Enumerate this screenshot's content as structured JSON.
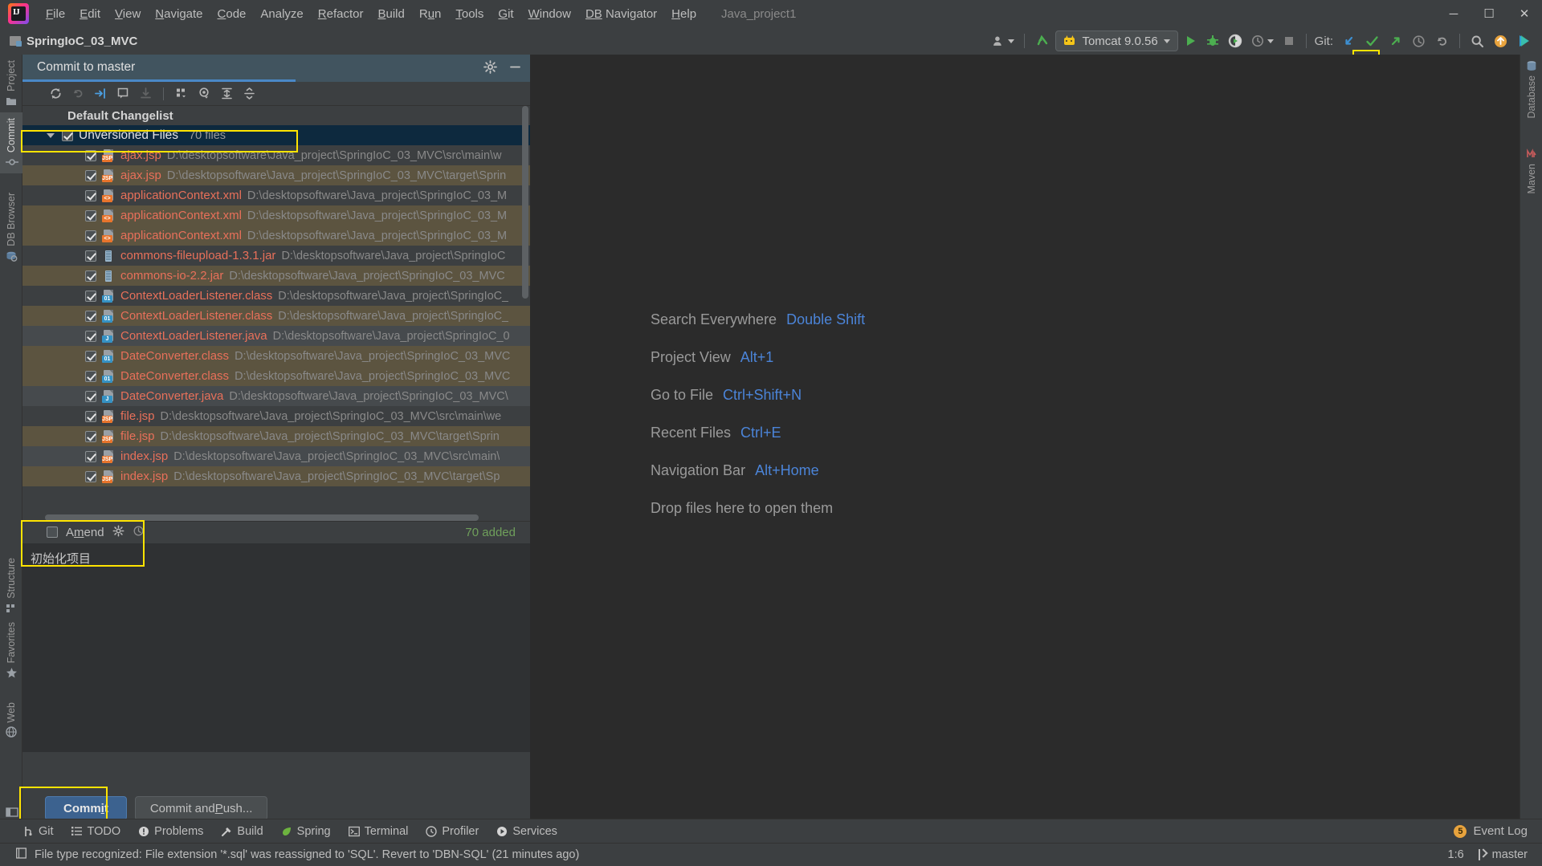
{
  "window": {
    "title": "Java_project1",
    "controls": {
      "minimize": "—",
      "maximize": "❐",
      "close": "✕"
    }
  },
  "menubar": {
    "logo": "intellij-idea-logo",
    "items": [
      {
        "label": "File",
        "mnemonic": "F"
      },
      {
        "label": "Edit",
        "mnemonic": "E"
      },
      {
        "label": "View",
        "mnemonic": "V"
      },
      {
        "label": "Navigate",
        "mnemonic": "N"
      },
      {
        "label": "Code",
        "mnemonic": "C"
      },
      {
        "label": "Analyze",
        "mnemonic": ""
      },
      {
        "label": "Refactor",
        "mnemonic": "R"
      },
      {
        "label": "Build",
        "mnemonic": "B"
      },
      {
        "label": "Run",
        "mnemonic": "u"
      },
      {
        "label": "Tools",
        "mnemonic": "T"
      },
      {
        "label": "Git",
        "mnemonic": "G"
      },
      {
        "label": "Window",
        "mnemonic": "W"
      },
      {
        "label": "DB Navigator",
        "mnemonic": "DB"
      },
      {
        "label": "Help",
        "mnemonic": "H"
      }
    ]
  },
  "navbar": {
    "project_name": "SpringIoC_03_MVC",
    "run_config": "Tomcat 9.0.56",
    "git_label": "Git:",
    "icons": {
      "user": "user-icon",
      "update_project": "update-project-icon",
      "run": "run-icon",
      "debug": "debug-icon",
      "run_coverage": "run-with-coverage-icon",
      "profile": "profile-icon",
      "stop": "stop-icon",
      "git_update": "git-update-icon",
      "git_commit": "git-commit-checkmark-icon",
      "git_push": "git-push-icon",
      "git_history": "git-history-icon",
      "git_rollback": "git-rollback-icon",
      "search": "search-icon",
      "ide_update": "ide-update-icon",
      "run_dashboard": "run-dashboard-icon"
    }
  },
  "left_strip": [
    {
      "label": "Project",
      "icon": "project-folder-icon",
      "active": false
    },
    {
      "label": "Commit",
      "icon": "commit-icon",
      "active": true
    },
    {
      "label": "DB Browser",
      "icon": "db-browser-icon",
      "active": false
    },
    {
      "label": "Structure",
      "icon": "structure-icon",
      "active": false
    },
    {
      "label": "Favorites",
      "icon": "star-icon",
      "active": false
    },
    {
      "label": "Web",
      "icon": "web-globe-icon",
      "active": false
    }
  ],
  "right_strip": [
    {
      "label": "Database",
      "icon": "database-icon"
    },
    {
      "label": "Maven",
      "icon": "maven-icon"
    }
  ],
  "commit_panel": {
    "tab_title": "Commit to master",
    "header_icons": {
      "settings": "gear-icon",
      "hide": "minimize-icon"
    },
    "toolbar_icons": [
      "refresh-icon",
      "rollback-icon",
      "diff-icon",
      "show-diff-icon",
      "download-icon",
      "group-by-icon",
      "preview-icon",
      "expand-all-icon",
      "collapse-all-icon"
    ],
    "changelist_title": "Default Changelist",
    "group": {
      "name": "Unversioned Files",
      "count": "70 files",
      "checked": true,
      "expanded": true,
      "highlighted": true
    },
    "files": [
      {
        "name": "ajax.jsp",
        "path": "D:\\desktopsoftware\\Java_project\\SpringIoC_03_MVC\\src\\main\\w",
        "type": "jsp",
        "checked": true,
        "row_style": "normal"
      },
      {
        "name": "ajax.jsp",
        "path": "D:\\desktopsoftware\\Java_project\\SpringIoC_03_MVC\\target\\Sprin",
        "type": "jsp",
        "checked": true,
        "row_style": "alt"
      },
      {
        "name": "applicationContext.xml",
        "path": "D:\\desktopsoftware\\Java_project\\SpringIoC_03_M",
        "type": "xml",
        "checked": true,
        "row_style": "normal"
      },
      {
        "name": "applicationContext.xml",
        "path": "D:\\desktopsoftware\\Java_project\\SpringIoC_03_M",
        "type": "xml",
        "checked": true,
        "row_style": "alt"
      },
      {
        "name": "applicationContext.xml",
        "path": "D:\\desktopsoftware\\Java_project\\SpringIoC_03_M",
        "type": "xml",
        "checked": true,
        "row_style": "alt"
      },
      {
        "name": "commons-fileupload-1.3.1.jar",
        "path": "D:\\desktopsoftware\\Java_project\\SpringIoC",
        "type": "jar",
        "checked": true,
        "row_style": "normal"
      },
      {
        "name": "commons-io-2.2.jar",
        "path": "D:\\desktopsoftware\\Java_project\\SpringIoC_03_MVC",
        "type": "jar",
        "checked": true,
        "row_style": "alt"
      },
      {
        "name": "ContextLoaderListener.class",
        "path": "D:\\desktopsoftware\\Java_project\\SpringIoC_",
        "type": "class",
        "checked": true,
        "row_style": "normal"
      },
      {
        "name": "ContextLoaderListener.class",
        "path": "D:\\desktopsoftware\\Java_project\\SpringIoC_",
        "type": "class",
        "checked": true,
        "row_style": "alt"
      },
      {
        "name": "ContextLoaderListener.java",
        "path": "D:\\desktopsoftware\\Java_project\\SpringIoC_0",
        "type": "java",
        "checked": true,
        "row_style": "sel"
      },
      {
        "name": "DateConverter.class",
        "path": "D:\\desktopsoftware\\Java_project\\SpringIoC_03_MVC",
        "type": "class",
        "checked": true,
        "row_style": "alt"
      },
      {
        "name": "DateConverter.class",
        "path": "D:\\desktopsoftware\\Java_project\\SpringIoC_03_MVC",
        "type": "class",
        "checked": true,
        "row_style": "alt"
      },
      {
        "name": "DateConverter.java",
        "path": "D:\\desktopsoftware\\Java_project\\SpringIoC_03_MVC\\",
        "type": "java",
        "checked": true,
        "row_style": "sel"
      },
      {
        "name": "file.jsp",
        "path": "D:\\desktopsoftware\\Java_project\\SpringIoC_03_MVC\\src\\main\\we",
        "type": "jsp",
        "checked": true,
        "row_style": "normal"
      },
      {
        "name": "file.jsp",
        "path": "D:\\desktopsoftware\\Java_project\\SpringIoC_03_MVC\\target\\Sprin",
        "type": "jsp",
        "checked": true,
        "row_style": "alt"
      },
      {
        "name": "index.jsp",
        "path": "D:\\desktopsoftware\\Java_project\\SpringIoC_03_MVC\\src\\main\\",
        "type": "jsp",
        "checked": true,
        "row_style": "sel"
      },
      {
        "name": "index.jsp",
        "path": "D:\\desktopsoftware\\Java_project\\SpringIoC_03_MVC\\target\\Sp",
        "type": "jsp",
        "checked": true,
        "row_style": "alt"
      }
    ],
    "amend": {
      "label": "Amend",
      "checked": false,
      "mnemonic": "m"
    },
    "added_count": "70 added",
    "commit_message": "初始化项目",
    "commit_message_highlighted": true,
    "buttons": {
      "commit": "Commit",
      "commit_and_push": "Commit and Push..."
    }
  },
  "editor": {
    "tips": [
      {
        "name": "Search Everywhere",
        "key": "Double Shift"
      },
      {
        "name": "Project View",
        "key": "Alt+1"
      },
      {
        "name": "Go to File",
        "key": "Ctrl+Shift+N"
      },
      {
        "name": "Recent Files",
        "key": "Ctrl+E"
      },
      {
        "name": "Navigation Bar",
        "key": "Alt+Home"
      }
    ],
    "drop_hint": "Drop files here to open them"
  },
  "bottom_toolbar": {
    "items": [
      {
        "label": "Git",
        "icon": "git-branch-icon"
      },
      {
        "label": "TODO",
        "icon": "todo-list-icon"
      },
      {
        "label": "Problems",
        "icon": "problems-icon"
      },
      {
        "label": "Build",
        "icon": "build-hammer-icon"
      },
      {
        "label": "Spring",
        "icon": "spring-leaf-icon"
      },
      {
        "label": "Terminal",
        "icon": "terminal-icon"
      },
      {
        "label": "Profiler",
        "icon": "profiler-icon"
      },
      {
        "label": "Services",
        "icon": "services-icon"
      }
    ],
    "event_log": {
      "label": "Event Log",
      "badge": "5"
    }
  },
  "statusbar": {
    "message": "File type recognized: File extension '*.sql' was reassigned to 'SQL'. Revert to 'DBN-SQL' (21 minutes ago)",
    "caret_position": "1:6",
    "branch": "master"
  },
  "colors": {
    "highlight": "#ffe400",
    "accent_blue": "#4b84d8",
    "file_red": "#e8705a",
    "added_green": "#6f9f5b",
    "selection": "#0d293e",
    "alt_row": "#5c5440"
  }
}
